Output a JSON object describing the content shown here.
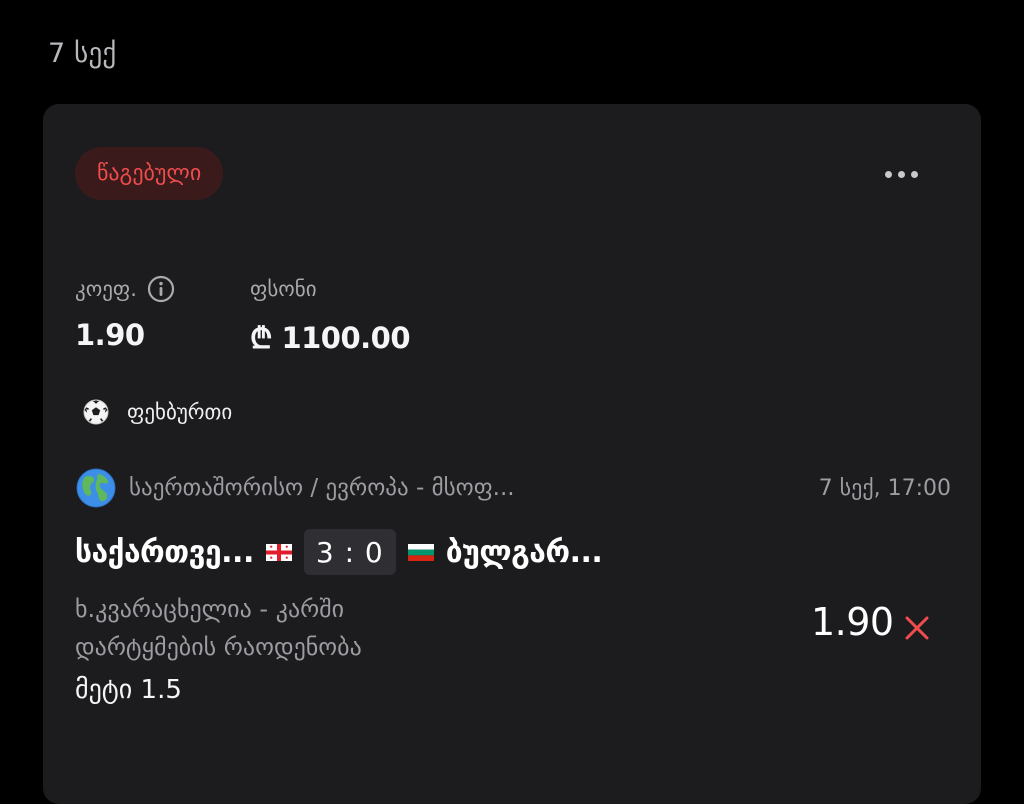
{
  "date_header": "7 სექ",
  "bet": {
    "status": "წაგებული",
    "coef_label": "კოეფ.",
    "coef_value": "1.90",
    "stake_label": "ფსონი",
    "stake_value": "₾ 1100.00",
    "sport": "ფეხბურთი",
    "league": "საერთაშორისო / ევროპა - მსოფ...",
    "match_time": "7 სექ, 17:00",
    "home_team": "საქართვე...",
    "score": "3 : 0",
    "away_team": "ბულგარ...",
    "market_line1": "ხ.კვარაცხელია - კარში",
    "market_line2": "დარტყმების რაოდენობა",
    "selection": "მეტი 1.5",
    "odd": "1.90"
  },
  "icons": {
    "more": "more-dots-icon",
    "info": "info-icon",
    "sport": "soccer-ball-icon",
    "league": "globe-icon",
    "result": "close-x-icon",
    "home_flag": "georgia-flag-icon",
    "away_flag": "bulgaria-flag-icon"
  },
  "colors": {
    "background": "#000000",
    "card": "#1c1c1e",
    "lost_text": "#ef4d4d",
    "lost_badge_bg": "#3a1a1b",
    "muted_text": "#9c9ca2",
    "score_bg": "#2f2f33"
  }
}
